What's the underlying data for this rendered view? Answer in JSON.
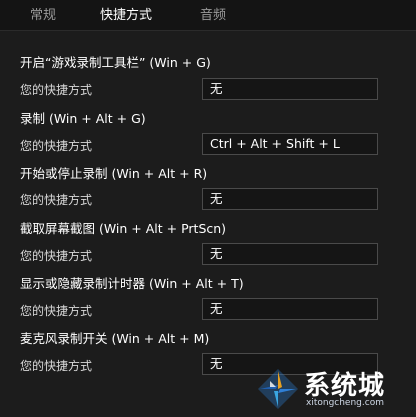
{
  "tabs": [
    {
      "label": "常规",
      "active": false
    },
    {
      "label": "快捷方式",
      "active": true
    },
    {
      "label": "音频",
      "active": false
    }
  ],
  "row_label": "您的快捷方式",
  "shortcuts": [
    {
      "title": "开启“游戏录制工具栏” (Win + G)",
      "value": "无"
    },
    {
      "title": "录制 (Win + Alt + G)",
      "value": "Ctrl + Alt + Shift + L"
    },
    {
      "title": "开始或停止录制 (Win + Alt + R)",
      "value": "无"
    },
    {
      "title": "截取屏幕截图 (Win + Alt + PrtScn)",
      "value": "无"
    },
    {
      "title": "显示或隐藏录制计时器 (Win + Alt + T)",
      "value": "无"
    },
    {
      "title": "麦克风录制开关 (Win + Alt + M)",
      "value": "无"
    }
  ],
  "watermark": {
    "text": "系统城",
    "url": "xitongcheng.com"
  },
  "colors": {
    "background": "#1c1c1c",
    "field_border": "#4a4a4a",
    "tab_inactive": "#9a9a9a"
  }
}
